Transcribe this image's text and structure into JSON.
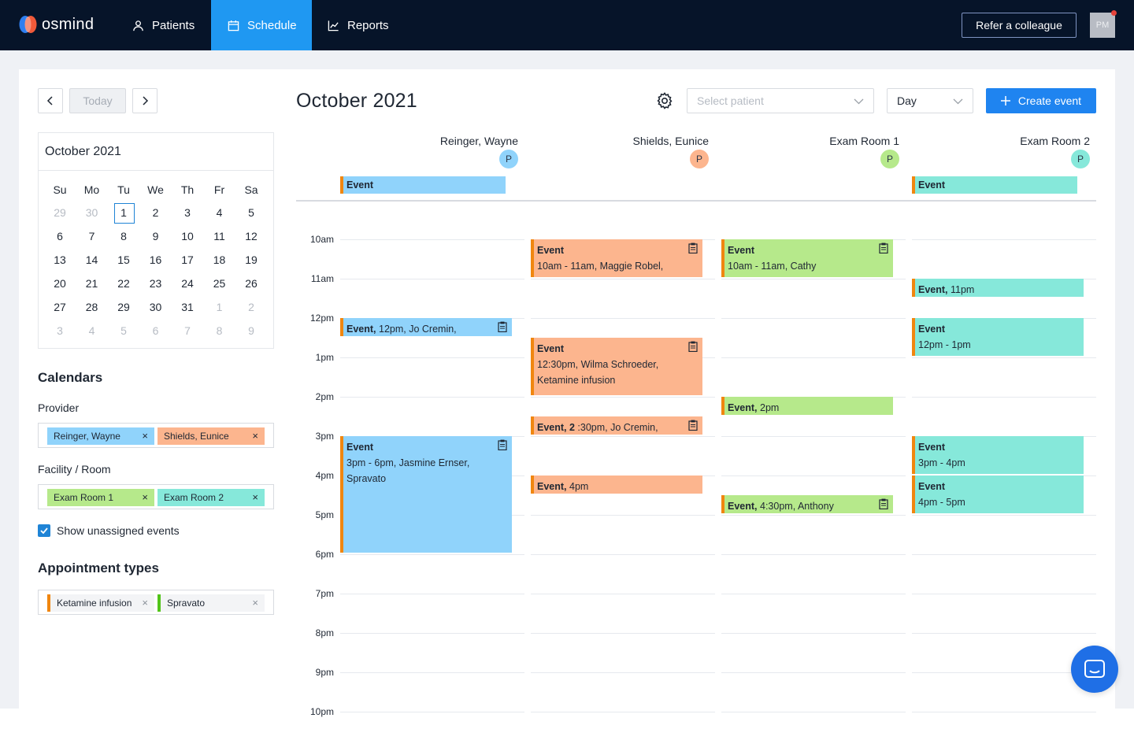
{
  "brand": "osmind",
  "nav": {
    "patients": "Patients",
    "schedule": "Schedule",
    "reports": "Reports",
    "refer": "Refer a colleague",
    "avatar": "PM"
  },
  "controls": {
    "today": "Today",
    "month_title": "October 2021",
    "select_patient_placeholder": "Select patient",
    "view": "Day",
    "create": "Create event"
  },
  "mini_calendar": {
    "title": "October 2021",
    "weekdays": [
      "Su",
      "Mo",
      "Tu",
      "We",
      "Th",
      "Fr",
      "Sa"
    ],
    "weeks": [
      [
        "29",
        "30",
        "1",
        "2",
        "3",
        "4",
        "5"
      ],
      [
        "6",
        "7",
        "8",
        "9",
        "10",
        "11",
        "12"
      ],
      [
        "13",
        "14",
        "15",
        "16",
        "17",
        "18",
        "19"
      ],
      [
        "20",
        "21",
        "22",
        "23",
        "24",
        "25",
        "26"
      ],
      [
        "27",
        "28",
        "29",
        "30",
        "31",
        "1",
        "2"
      ],
      [
        "3",
        "4",
        "5",
        "6",
        "7",
        "8",
        "9"
      ]
    ]
  },
  "sidebar": {
    "calendars_title": "Calendars",
    "provider_label": "Provider",
    "providers": [
      "Reinger, Wayne",
      "Shields, Eunice"
    ],
    "facility_label": "Facility / Room",
    "rooms": [
      "Exam Room 1",
      "Exam Room 2"
    ],
    "show_unassigned": "Show unassigned events",
    "appt_types_title": "Appointment types",
    "appt_types": [
      "Ketamine infusion",
      "Spravato"
    ],
    "remove_glyph": "×"
  },
  "columns": [
    {
      "name": "Reinger, Wayne",
      "badge": "P",
      "color": "#90d3fb"
    },
    {
      "name": "Shields, Eunice",
      "badge": "P",
      "color": "#fcb58e"
    },
    {
      "name": "Exam Room 1",
      "badge": "P",
      "color": "#b6e98b"
    },
    {
      "name": "Exam Room 2",
      "badge": "P",
      "color": "#86e8da"
    }
  ],
  "hours": [
    "10am",
    "11am",
    "12pm",
    "1pm",
    "2pm",
    "3pm",
    "4pm",
    "5pm",
    "6pm",
    "7pm",
    "8pm",
    "9pm",
    "10pm"
  ],
  "allday_events": [
    {
      "title": "Event",
      "col": 0
    },
    {
      "title": "Event",
      "col": 3
    }
  ],
  "events": [
    {
      "title": "Event",
      "detail": "10am - 11am, Maggie Robel,",
      "col": 1
    },
    {
      "title": "Event",
      "detail": "10am - 11am, Cathy",
      "col": 2
    },
    {
      "title": "Event,",
      "detail": "11pm",
      "col": 3
    },
    {
      "title": "Event,",
      "detail": "12pm, Jo Cremin,",
      "col": 0
    },
    {
      "title": "Event",
      "detail": "12pm - 1pm",
      "col": 3
    },
    {
      "title": "Event",
      "detail": "12:30pm, Wilma Schroeder,",
      "extra": "Ketamine infusion",
      "col": 1
    },
    {
      "title": "Event,",
      "detail": "2pm",
      "col": 2
    },
    {
      "title": "Event, 2",
      "detail": ":30pm, Jo Cremin,",
      "col": 1
    },
    {
      "title": "Event",
      "detail": "3pm - 6pm, Jasmine Ernser,",
      "extra": "Spravato",
      "col": 0
    },
    {
      "title": "Event",
      "detail": "3pm - 4pm",
      "col": 3
    },
    {
      "title": "Event,",
      "detail": "4pm",
      "col": 1
    },
    {
      "title": "Event",
      "detail": "4pm - 5pm",
      "col": 3
    },
    {
      "title": "Event,",
      "detail": "4:30pm, Anthony",
      "col": 2
    }
  ],
  "colors": {
    "nav_bg": "#061429",
    "schedule_active": "#1f98f2",
    "primary": "#1f84f0",
    "accent_bar": "#f0860f",
    "spravato_bar": "#52c41a"
  }
}
